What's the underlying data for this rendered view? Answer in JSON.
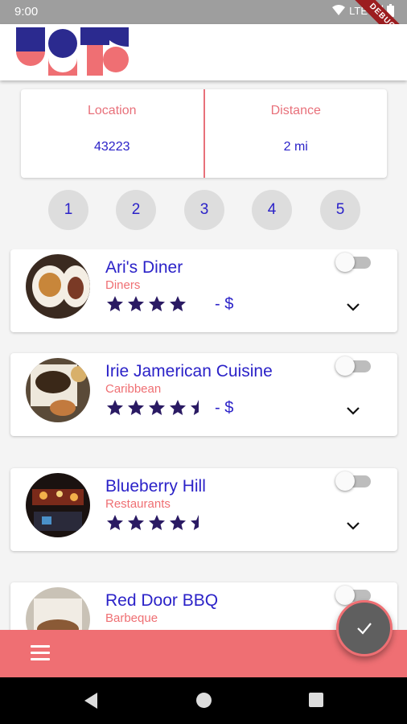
{
  "status_bar": {
    "time": "9:00",
    "network": "LTE"
  },
  "debug_banner": "DEBUG",
  "filters": {
    "location_label": "Location",
    "location_value": "43223",
    "distance_label": "Distance",
    "distance_value": "2 mi"
  },
  "pages": [
    "1",
    "2",
    "3",
    "4",
    "5"
  ],
  "restaurants": [
    {
      "name": "Ari's Diner",
      "category": "Diners",
      "rating": 4,
      "price": "- $",
      "selected": false
    },
    {
      "name": "Irie Jamerican Cuisine",
      "category": "Caribbean",
      "rating": 4.5,
      "price": "- $",
      "selected": false
    },
    {
      "name": "Blueberry Hill",
      "category": "Restaurants",
      "rating": 4.5,
      "price": "",
      "selected": false
    },
    {
      "name": "Red Door BBQ",
      "category": "Barbeque",
      "rating": 0,
      "price": "",
      "selected": false
    }
  ],
  "colors": {
    "accent": "#ef6f73",
    "text_primary": "#2b22c8",
    "star": "#2a1a63"
  }
}
